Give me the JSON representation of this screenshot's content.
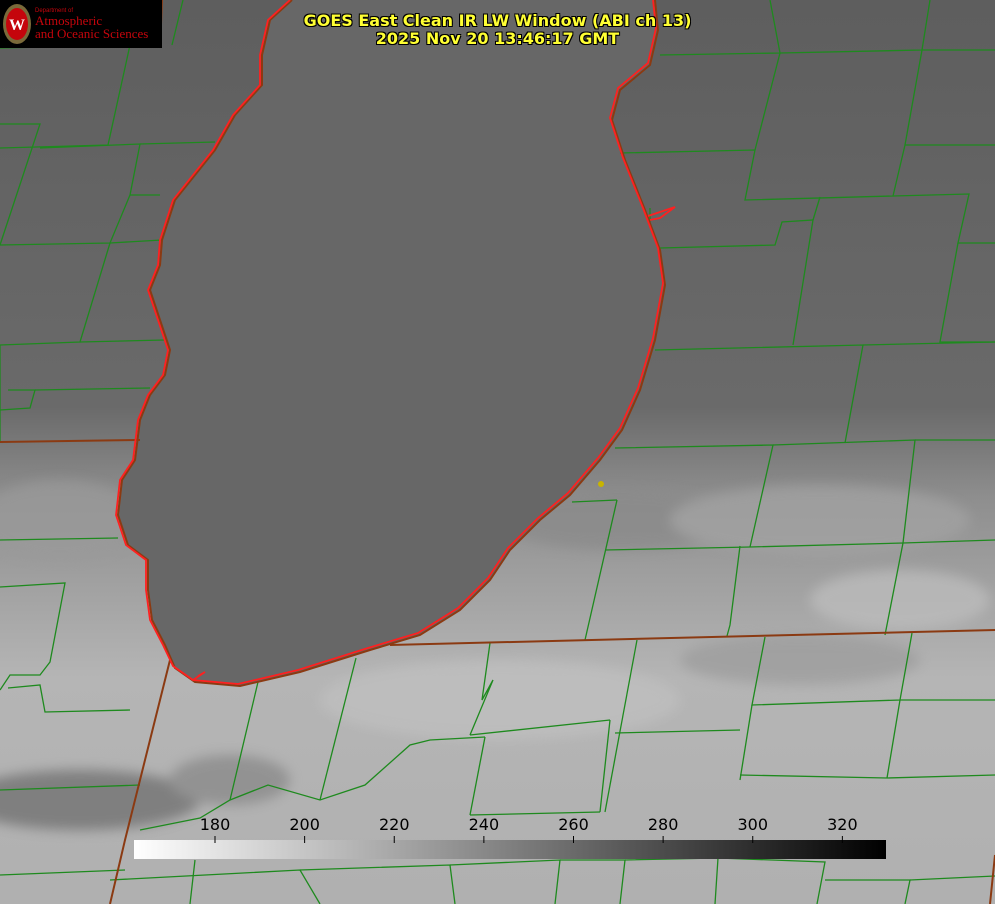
{
  "logo": {
    "department": "Department of",
    "line1": "Atmospheric",
    "line2": "and Oceanic Sciences",
    "crest_letter": "W"
  },
  "title": {
    "line1": "GOES East Clean IR LW Window (ABI ch 13)",
    "line2": "2025 Nov 20 13:46:17 GMT"
  },
  "colorbar": {
    "ticks": [
      {
        "value": 180,
        "label": "180"
      },
      {
        "value": 200,
        "label": "200"
      },
      {
        "value": 220,
        "label": "220"
      },
      {
        "value": 240,
        "label": "240"
      },
      {
        "value": 260,
        "label": "260"
      },
      {
        "value": 280,
        "label": "280"
      },
      {
        "value": 300,
        "label": "300"
      },
      {
        "value": 320,
        "label": "320"
      }
    ],
    "colormap": "white-to-black grayscale"
  },
  "colors": {
    "title": "#ffff33",
    "county_lines": "#1e8a1e",
    "state_lines": "#8b3a12",
    "lake_shore": "#ff2020",
    "logo_red": "#c5050c",
    "marker": "#c8b400"
  }
}
